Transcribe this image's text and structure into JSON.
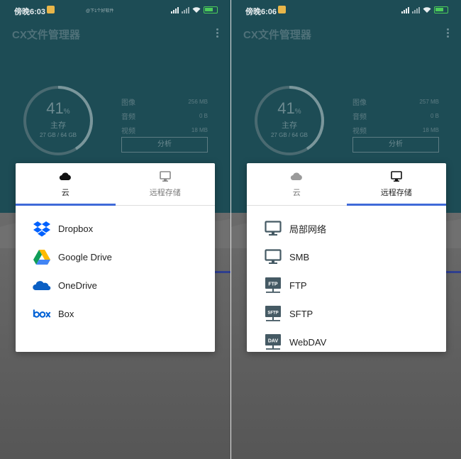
{
  "screens": [
    {
      "status": {
        "time": "傍晚6:03",
        "watermark": "@下1个好软件"
      },
      "app_title": "CX文件管理器",
      "storage": {
        "percent": "41",
        "percent_sign": "%",
        "label": "主存",
        "size": "27 GB / 64 GB",
        "usage_fraction": 0.41,
        "stats": [
          {
            "label": "图像",
            "value": "256 MB"
          },
          {
            "label": "音频",
            "value": "0 B"
          },
          {
            "label": "视频",
            "value": "18 MB"
          }
        ],
        "analyze_label": "分析"
      },
      "dialog": {
        "tabs": [
          {
            "label": "云",
            "icon": "cloud-icon"
          },
          {
            "label": "远程存储",
            "icon": "monitor-icon"
          }
        ],
        "active_tab": 0,
        "items": [
          {
            "label": "Dropbox",
            "icon": "dropbox-icon"
          },
          {
            "label": "Google Drive",
            "icon": "google-drive-icon"
          },
          {
            "label": "OneDrive",
            "icon": "onedrive-icon"
          },
          {
            "label": "Box",
            "icon": "box-icon"
          }
        ]
      }
    },
    {
      "status": {
        "time": "傍晚6:06"
      },
      "app_title": "CX文件管理器",
      "storage": {
        "percent": "41",
        "percent_sign": "%",
        "label": "主存",
        "size": "27 GB / 64 GB",
        "usage_fraction": 0.41,
        "stats": [
          {
            "label": "图像",
            "value": "257 MB"
          },
          {
            "label": "音频",
            "value": "0 B"
          },
          {
            "label": "视频",
            "value": "18 MB"
          }
        ],
        "analyze_label": "分析"
      },
      "dialog": {
        "tabs": [
          {
            "label": "云",
            "icon": "cloud-icon"
          },
          {
            "label": "远程存储",
            "icon": "monitor-icon"
          }
        ],
        "active_tab": 1,
        "items": [
          {
            "label": "局部网络",
            "icon": "monitor-icon"
          },
          {
            "label": "SMB",
            "icon": "monitor-icon"
          },
          {
            "label": "FTP",
            "icon": "ftp-server-icon",
            "badge": "FTP"
          },
          {
            "label": "SFTP",
            "icon": "sftp-server-icon",
            "badge": "SFTP"
          },
          {
            "label": "WebDAV",
            "icon": "webdav-server-icon",
            "badge": "DAV"
          }
        ]
      }
    }
  ],
  "colors": {
    "teal_header": "#1d4c55",
    "tab_indicator": "#3f6ad8",
    "dropbox": "#0061fe",
    "onedrive": "#0a5fc4",
    "box": "#0061d5",
    "server_icon": "#455a64"
  }
}
